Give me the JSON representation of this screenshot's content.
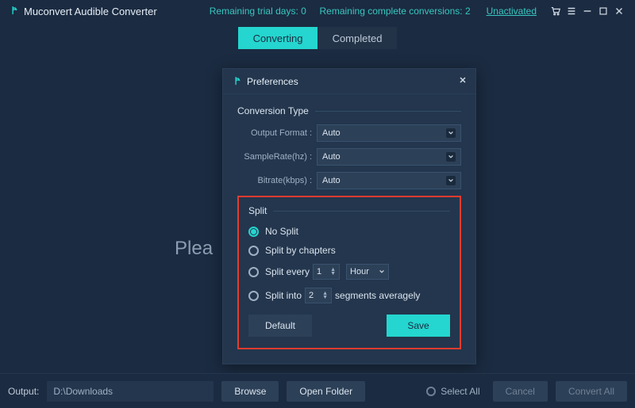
{
  "app": {
    "title": "Muconvert Audible Converter"
  },
  "header": {
    "trial_days_label": "Remaining trial days:",
    "trial_days_value": "0",
    "conversions_label": "Remaining complete conversions:",
    "conversions_value": "2",
    "unactivated": "Unactivated"
  },
  "tabs": {
    "converting": "Converting",
    "completed": "Completed"
  },
  "behind_text": "Plea",
  "modal": {
    "title": "Preferences",
    "section_conversion": "Conversion Type",
    "output_format_label": "Output Format :",
    "output_format_value": "Auto",
    "samplerate_label": "SampleRate(hz) :",
    "samplerate_value": "Auto",
    "bitrate_label": "Bitrate(kbps) :",
    "bitrate_value": "Auto",
    "section_split": "Split",
    "opt_nosplit": "No Split",
    "opt_chapters": "Split by chapters",
    "opt_every_prefix": "Split every",
    "opt_every_value": "1",
    "opt_every_unit": "Hour",
    "opt_into_prefix": "Split into",
    "opt_into_value": "2",
    "opt_into_suffix": "segments averagely",
    "btn_default": "Default",
    "btn_save": "Save"
  },
  "footer": {
    "output_label": "Output:",
    "output_path": "D:\\Downloads",
    "browse": "Browse",
    "open_folder": "Open Folder",
    "select_all": "Select All",
    "cancel": "Cancel",
    "convert_all": "Convert All"
  }
}
